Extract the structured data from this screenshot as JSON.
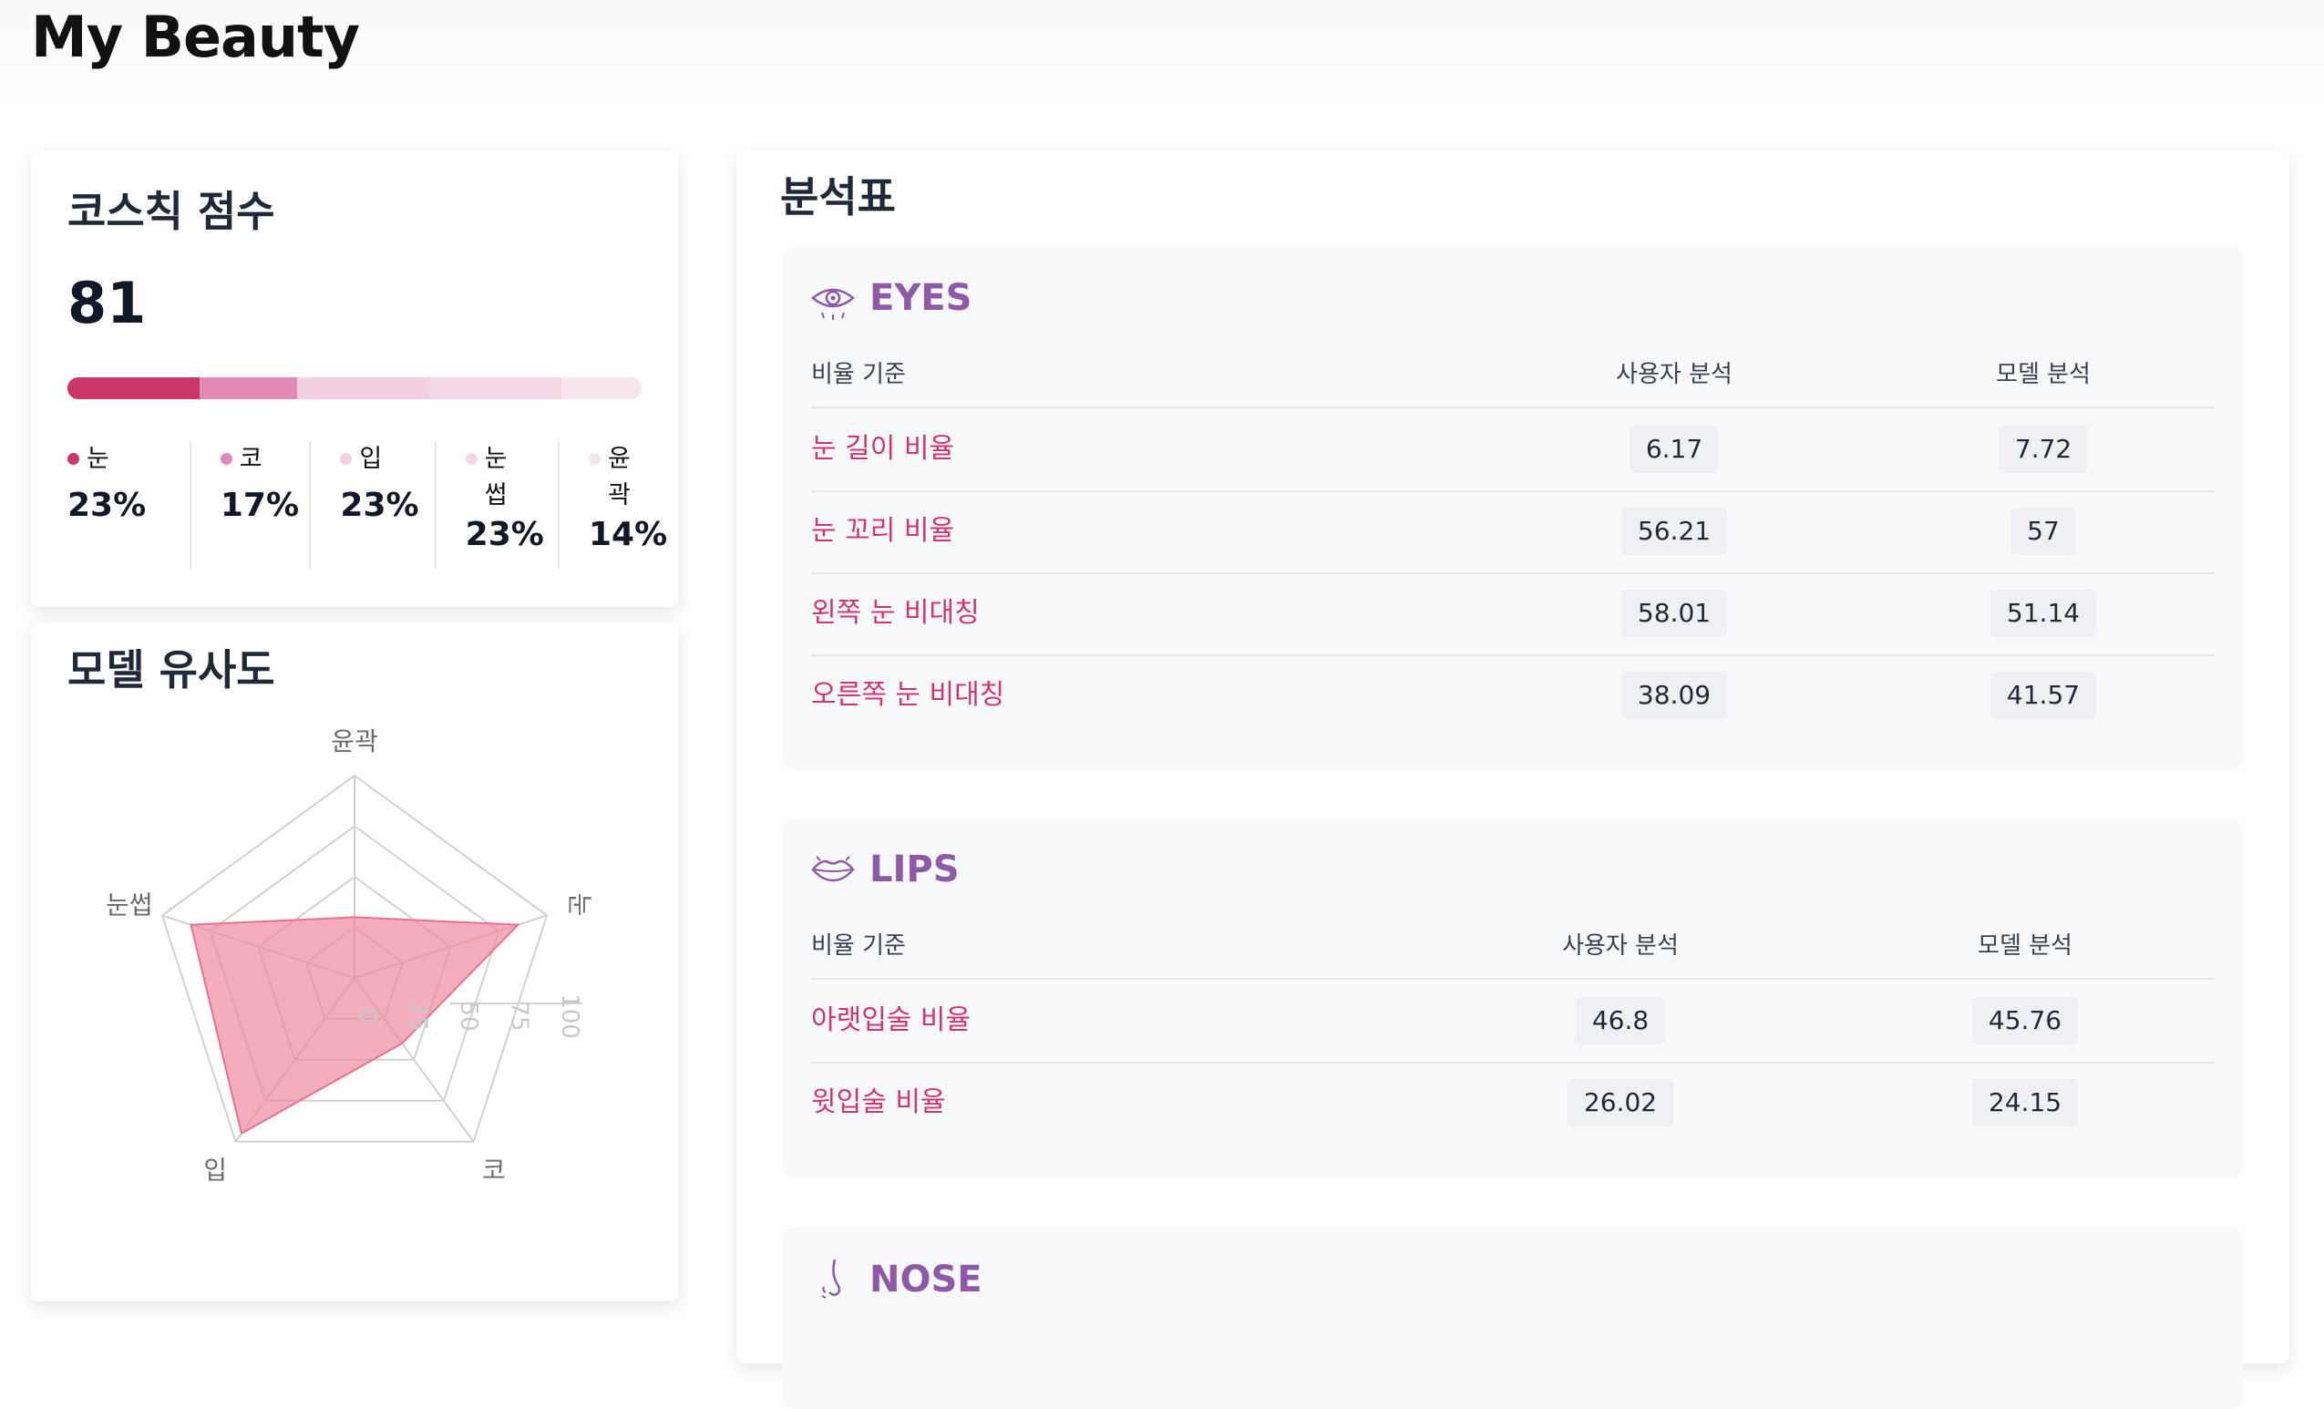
{
  "page": {
    "title": "My Beauty"
  },
  "score_card": {
    "title": "코스칙 점수",
    "score": "81",
    "legend": [
      {
        "name": "눈",
        "pct": "23%",
        "color": "#c9376a",
        "value": 23
      },
      {
        "name": "코",
        "pct": "17%",
        "color": "#e28ab6",
        "value": 17
      },
      {
        "name": "입",
        "pct": "23%",
        "color": "#f2d0e2",
        "value": 23
      },
      {
        "name": "눈썹",
        "pct": "23%",
        "color": "#f4d7e7",
        "value": 23
      },
      {
        "name": "윤곽",
        "pct": "14%",
        "color": "#f8e6ef",
        "value": 14
      }
    ]
  },
  "similarity_card": {
    "title": "모델 유사도",
    "chart_data": {
      "type": "radar",
      "axes": [
        "윤곽",
        "눈",
        "코",
        "입",
        "눈썹"
      ],
      "values": [
        30,
        85,
        40,
        95,
        85
      ],
      "ticks": [
        "0",
        "25",
        "50",
        "75",
        "100"
      ],
      "range": [
        0,
        100
      ],
      "fill_color": "#f08aa0",
      "stroke_color": "#e9718b"
    }
  },
  "analysis": {
    "title": "분석표",
    "headers": {
      "criterion": "비율 기준",
      "user": "사용자 분석",
      "model": "모델 분석"
    },
    "sections": [
      {
        "title": "EYES",
        "icon": "eye-icon",
        "rows": [
          {
            "name": "눈 길이 비율",
            "user": "6.17",
            "model": "7.72"
          },
          {
            "name": "눈 꼬리 비율",
            "user": "56.21",
            "model": "57"
          },
          {
            "name": "왼쪽 눈 비대칭",
            "user": "58.01",
            "model": "51.14"
          },
          {
            "name": "오른쪽 눈 비대칭",
            "user": "38.09",
            "model": "41.57"
          }
        ]
      },
      {
        "title": "LIPS",
        "icon": "lips-icon",
        "rows": [
          {
            "name": "아랫입술 비율",
            "user": "46.8",
            "model": "45.76"
          },
          {
            "name": "윗입술 비율",
            "user": "26.02",
            "model": "24.15"
          }
        ]
      },
      {
        "title": "NOSE",
        "icon": "nose-icon",
        "rows": []
      }
    ]
  }
}
